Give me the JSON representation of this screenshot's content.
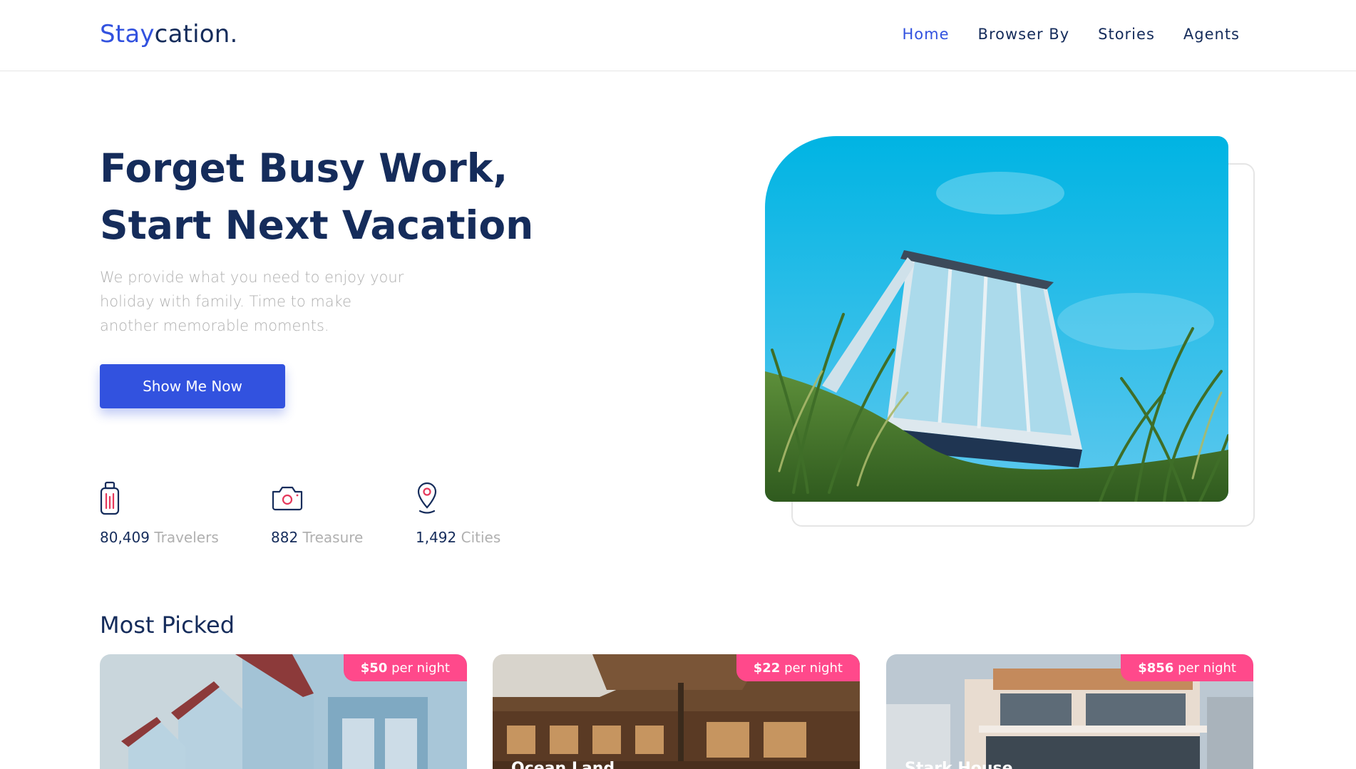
{
  "header": {
    "logo_accent": "Stay",
    "logo_rest": "cation.",
    "nav": [
      "Home",
      "Browser By",
      "Stories",
      "Agents"
    ],
    "active_nav": "Home"
  },
  "hero": {
    "title_line1": "Forget Busy Work,",
    "title_line2": "Start Next Vacation",
    "subtitle_line1": "We provide what you need to enjoy your",
    "subtitle_line2": "holiday with family. Time to make",
    "subtitle_line3": "another memorable moments.",
    "cta_label": "Show Me Now",
    "stats": [
      {
        "value": "80,409",
        "label": "Travelers",
        "icon": "luggage-icon"
      },
      {
        "value": "882",
        "label": "Treasure",
        "icon": "camera-icon"
      },
      {
        "value": "1,492",
        "label": "Cities",
        "icon": "map-pin-icon"
      }
    ]
  },
  "most_picked": {
    "title": "Most Picked",
    "cards": [
      {
        "price": "$50",
        "unit": "per night",
        "name": ""
      },
      {
        "price": "$22",
        "unit": "per night",
        "name": "Ocean Land"
      },
      {
        "price": "$856",
        "unit": "per night",
        "name": "Stark House"
      }
    ]
  },
  "colors": {
    "primary": "#3252df",
    "navy": "#152c5b",
    "muted": "#b0b0b0",
    "pink": "#ff498b",
    "icon_accent": "#e5385b"
  }
}
